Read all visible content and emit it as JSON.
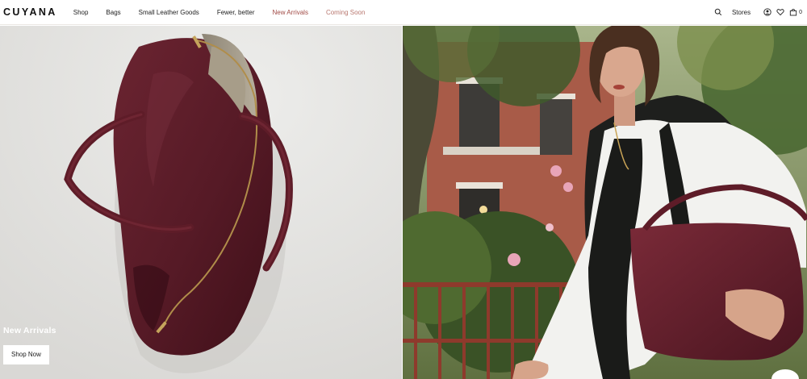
{
  "brand": {
    "logo_text": "CUYANA"
  },
  "nav": {
    "items": [
      {
        "label": "Shop"
      },
      {
        "label": "Bags"
      },
      {
        "label": "Small Leather Goods"
      },
      {
        "label": "Fewer, better"
      },
      {
        "label": "New Arrivals"
      },
      {
        "label": "Coming Soon"
      }
    ],
    "accent_color": "#a14a45"
  },
  "utility": {
    "search_icon": "search-icon",
    "stores_label": "Stores",
    "account_icon": "account-icon",
    "wishlist_icon": "heart-icon",
    "cart_icon": "bag-icon",
    "cart_count": "0"
  },
  "hero": {
    "title": "New Arrivals",
    "cta_label": "Shop Now",
    "left_image": "burgundy-leather-tote-bag",
    "right_image": "woman-carrying-burgundy-tote-on-city-street",
    "bag_color": "#5a1c26"
  }
}
